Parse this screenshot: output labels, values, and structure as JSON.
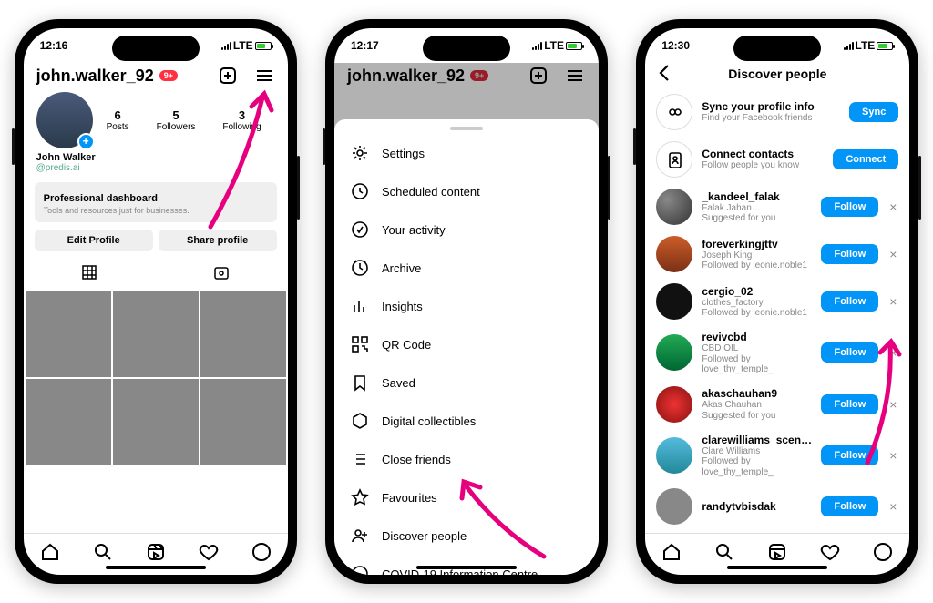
{
  "status": {
    "time1": "12:16",
    "time2": "12:17",
    "time3": "12:30",
    "net": "LTE"
  },
  "profile": {
    "username": "john.walker_92",
    "notif": "9+",
    "name": "John Walker",
    "handle": "@predis.ai",
    "stats": {
      "posts": {
        "n": "6",
        "l": "Posts"
      },
      "followers": {
        "n": "5",
        "l": "Followers"
      },
      "following": {
        "n": "3",
        "l": "Following"
      }
    },
    "dash": {
      "title": "Professional dashboard",
      "sub": "Tools and resources just for businesses."
    },
    "edit": "Edit Profile",
    "share": "Share profile"
  },
  "menu": {
    "items": [
      "Settings",
      "Scheduled content",
      "Your activity",
      "Archive",
      "Insights",
      "QR Code",
      "Saved",
      "Digital collectibles",
      "Close friends",
      "Favourites",
      "Discover people",
      "COVID-19 Information Centre"
    ]
  },
  "discover": {
    "title": "Discover people",
    "sync": {
      "t": "Sync your profile info",
      "s": "Find your Facebook friends",
      "b": "Sync"
    },
    "connect": {
      "t": "Connect contacts",
      "s": "Follow people you know",
      "b": "Connect"
    },
    "follow": "Follow",
    "list": [
      {
        "u": "_kandeel_falak",
        "s1": "Falak Jahan…",
        "s2": "Suggested for you"
      },
      {
        "u": "foreverkingjttv",
        "s1": "Joseph King",
        "s2": "Followed by leonie.noble1"
      },
      {
        "u": "cergio_02",
        "s1": "clothes_factory",
        "s2": "Followed by leonie.noble1"
      },
      {
        "u": "revivcbd",
        "s1": "CBD OIL",
        "s2": "Followed by love_thy_temple_"
      },
      {
        "u": "akaschauhan9",
        "s1": "Akas Chauhan",
        "s2": "Suggested for you"
      },
      {
        "u": "clarewilliams_scentsy…",
        "s1": "Clare Williams",
        "s2": "Followed by love_thy_temple_"
      },
      {
        "u": "randytvbisdak",
        "s1": "",
        "s2": ""
      }
    ]
  }
}
